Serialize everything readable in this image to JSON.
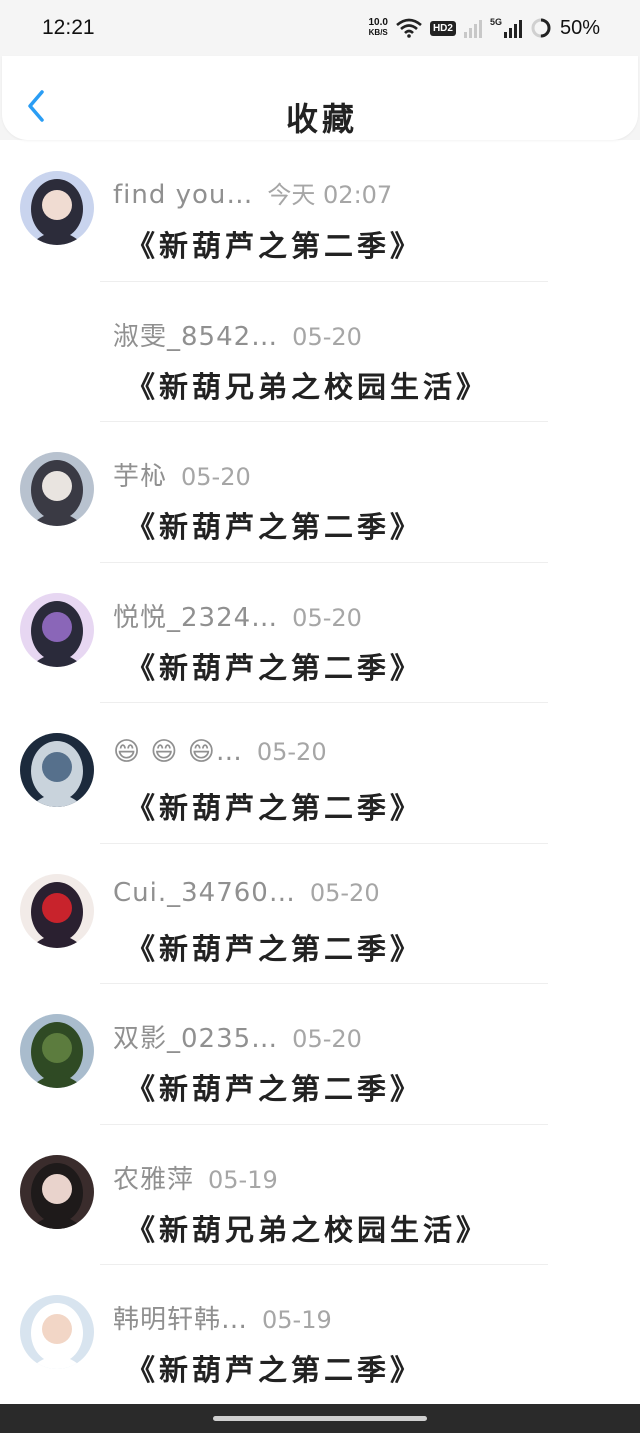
{
  "status_bar": {
    "time": "12:21",
    "net_speed_value": "10.0",
    "net_speed_unit": "KB/S",
    "hd_badge": "HD2",
    "network_type": "5G",
    "battery_percent": "50%",
    "battery_level": 0.5
  },
  "header": {
    "title": "收藏",
    "back_icon": "chevron-left-icon",
    "accent_color": "#2a9df4"
  },
  "favorites": [
    {
      "name": "find you…",
      "time": "今天 02:07",
      "title": "《新葫芦之第二季》",
      "avatar_colors": [
        "#c9d4ee",
        "#f0dcd2",
        "#2c2c3a"
      ]
    },
    {
      "name": "淑雯_8542…",
      "time": "05-20",
      "title": "《新葫兄弟之校园生活》",
      "avatar_colors": [
        "#ffffff",
        "#ffffff",
        "#ffffff"
      ]
    },
    {
      "name": "芋杺",
      "time": "05-20",
      "title": "《新葫芦之第二季》",
      "avatar_colors": [
        "#b8c2cf",
        "#e9e4e0",
        "#3a3a44"
      ]
    },
    {
      "name": "悦悦_2324…",
      "time": "05-20",
      "title": "《新葫芦之第二季》",
      "avatar_colors": [
        "#e7d7f2",
        "#8a66b8",
        "#2a2a3a"
      ]
    },
    {
      "name": "😄 😄 😄…",
      "time": "05-20",
      "title": "《新葫芦之第二季》",
      "avatar_colors": [
        "#1c2a3c",
        "#56708c",
        "#c9d3dc"
      ]
    },
    {
      "name": "Cui._34760…",
      "time": "05-20",
      "title": "《新葫芦之第二季》",
      "avatar_colors": [
        "#f2ebe8",
        "#c8232c",
        "#2a2030"
      ]
    },
    {
      "name": "双影_0235…",
      "time": "05-20",
      "title": "《新葫芦之第二季》",
      "avatar_colors": [
        "#a9bccd",
        "#5c7c3e",
        "#2f4a24"
      ]
    },
    {
      "name": "农雅萍",
      "time": "05-19",
      "title": "《新葫兄弟之校园生活》",
      "avatar_colors": [
        "#3a2c2c",
        "#e9d3cc",
        "#1e1a1a"
      ]
    },
    {
      "name": "韩明轩韩…",
      "time": "05-19",
      "title": "《新葫芦之第二季》",
      "avatar_colors": [
        "#d8e4ef",
        "#f2d6c6",
        "#ffffff"
      ]
    }
  ]
}
